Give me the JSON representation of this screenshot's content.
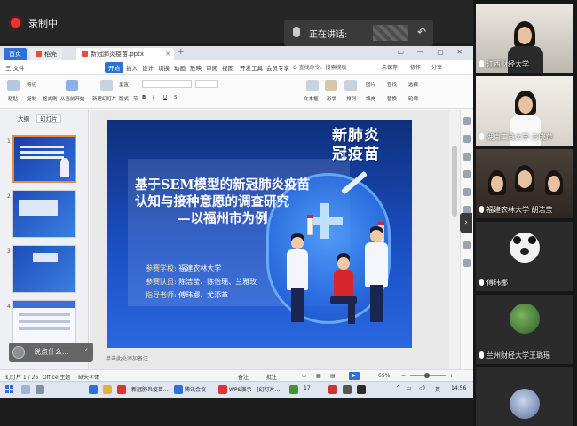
{
  "meeting": {
    "recording_label": "录制中",
    "speaking_label": "正在讲话:"
  },
  "wps": {
    "tabs": [
      {
        "label": "首页"
      },
      {
        "label": "稻壳"
      },
      {
        "label": "新冠肺炎疫苗.pptx"
      }
    ],
    "menu": [
      {
        "label": "三 文件"
      },
      {
        "label": "开始"
      },
      {
        "label": "插入"
      },
      {
        "label": "设计"
      },
      {
        "label": "切换"
      },
      {
        "label": "动画"
      },
      {
        "label": "放映"
      },
      {
        "label": "审阅"
      },
      {
        "label": "视图"
      },
      {
        "label": "开发工具"
      },
      {
        "label": "会员专享"
      }
    ],
    "search_placeholder": "Q 查找命令、搜索模板",
    "menu_right": [
      "未保存",
      "协作",
      "分享"
    ],
    "ribbon": {
      "paste": "粘贴",
      "cut": "剪切",
      "format_brush": "格式刷",
      "copy": "复制",
      "from_current": "从当前开始",
      "new_slide": "新建幻灯片",
      "layout": "版式",
      "section": "节",
      "reset": "重置",
      "text_box": "文本框",
      "shape": "形状",
      "arrange": "排列",
      "picture": "图片",
      "fill": "填充",
      "find": "查找",
      "replace": "替换",
      "select": "选择",
      "outline": "轮廓"
    },
    "view_tabs": [
      "大纲",
      "幻灯片"
    ],
    "slide_numbers": [
      "1",
      "2",
      "3",
      "4"
    ],
    "slide": {
      "title_lines": [
        "基于SEM模型的新冠肺炎疫苗",
        "认知与接种意愿的调查研究",
        "—以福州市为例"
      ],
      "meta": [
        {
          "key": "参赛学校:",
          "value": "福建农林大学"
        },
        {
          "key": "参赛队员:",
          "value": "陈洁莹、陈怡瑶、兰雅玫"
        },
        {
          "key": "指导老师:",
          "value": "傅玮娜、尤添革"
        }
      ],
      "logo_lines": [
        "新肺炎",
        "冠疫苗"
      ]
    },
    "notes_placeholder": "单击此处添加备注",
    "comment_prompt": "说点什么...",
    "status": {
      "slide_count": "幻灯片 1 / 26",
      "theme": "Office 主题",
      "missing_font": "缺失字体",
      "notes_toggle": "备注",
      "comment_toggle": "批注",
      "zoom": "65%"
    }
  },
  "taskbar": {
    "items": [
      {
        "label": "新冠肺炎疫苗..."
      },
      {
        "label": "腾讯会议"
      },
      {
        "label": "WPS演示 - [幻灯片..."
      }
    ],
    "tray_temp": "17",
    "lang": "英",
    "time": "14:56"
  },
  "participants": [
    {
      "name": "江西财经大学",
      "avatar": "camera",
      "color": "#6b6f77"
    },
    {
      "name": "湖南工商大学-方晓萍",
      "avatar": "camera",
      "color": "#cfc9c2"
    },
    {
      "name": "福建农林大学 胡洁莹",
      "avatar": "camera",
      "color": "#3b3430"
    },
    {
      "name": "傅玮娜",
      "avatar": "panda",
      "color": "#2b2b2b"
    },
    {
      "name": "兰州财经大学王璐瑶",
      "avatar": "photo",
      "color": "#2b2b2b"
    },
    {
      "name": "",
      "avatar": "photo",
      "color": "#2b2b2b"
    }
  ]
}
